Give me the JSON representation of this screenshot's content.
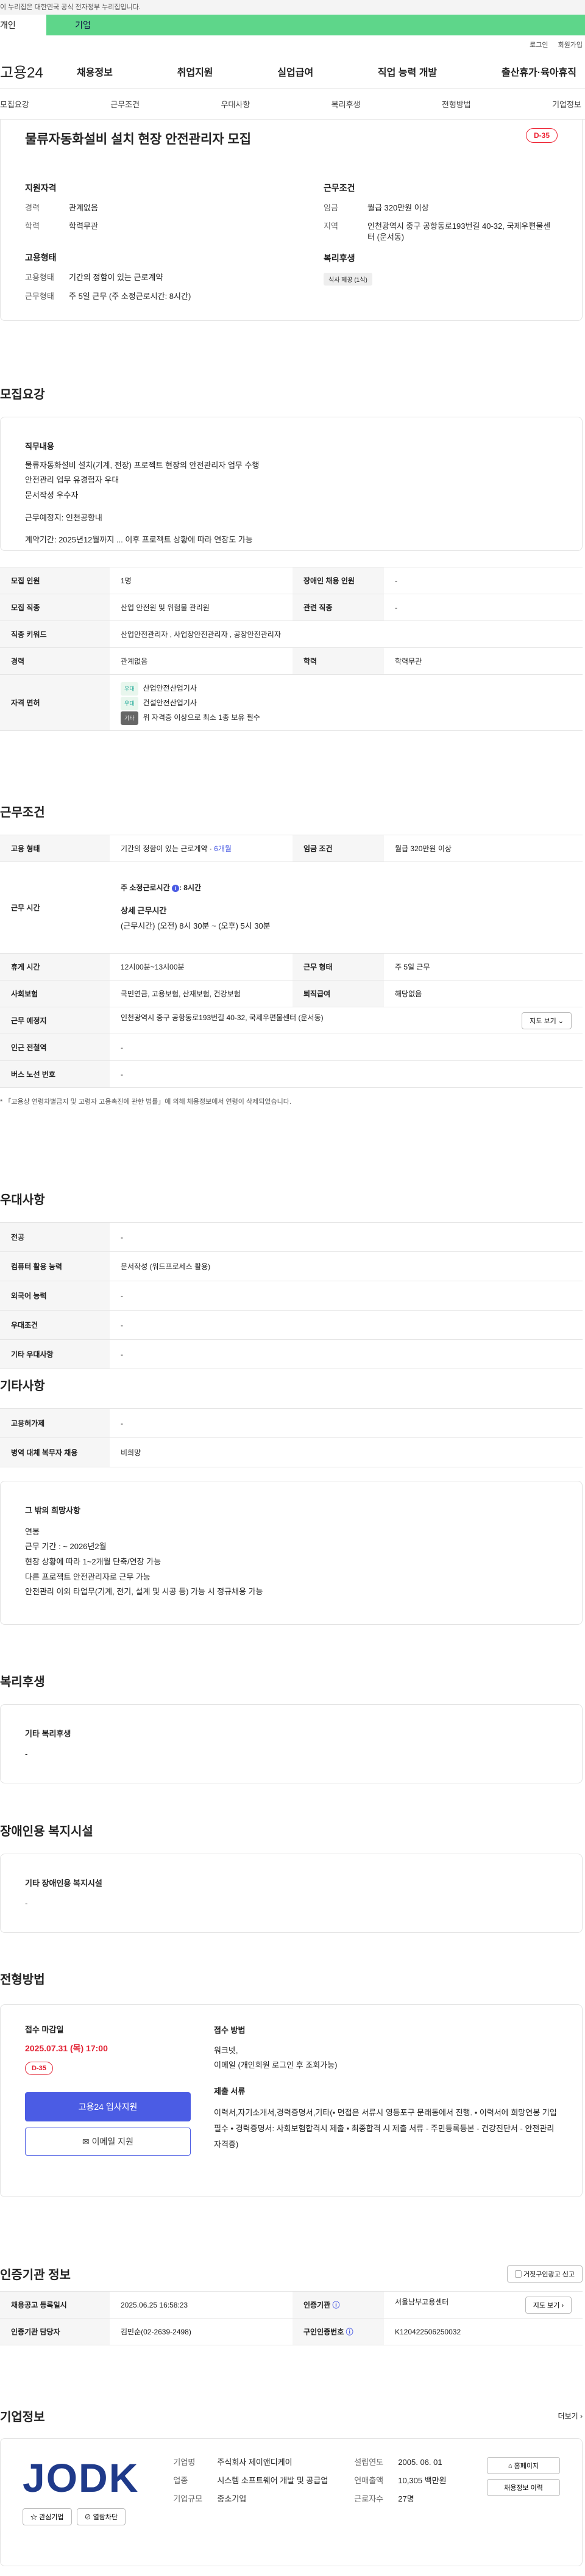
{
  "gov_notice": "이 누리집은 대한민국 공식 전자정부 누리집입니다.",
  "top_tabs": [
    "개인",
    "기업"
  ],
  "util": [
    "로그인",
    "회원가입"
  ],
  "logo": "고용24",
  "gnb": [
    "채용정보",
    "취업지원",
    "실업급여",
    "직업 능력 개발",
    "출산휴가·육아휴직"
  ],
  "subnav": [
    "모집요강",
    "근무조건",
    "우대사항",
    "복리후생",
    "전형방법",
    "기업정보"
  ],
  "title": "물류자동화설비 설치 현장 안전관리자 모집",
  "dday": "D-35",
  "summary": {
    "qual_h": "지원자격",
    "career_k": "경력",
    "career_v": "관계없음",
    "edu_k": "학력",
    "edu_v": "학력무관",
    "cond_h": "근무조건",
    "wage_k": "임금",
    "wage_v": "월급 320만원 이상",
    "area_k": "지역",
    "area_v": "인천광역시 중구 공항동로193번길 40-32, 국제우편물센터 (운서동)",
    "emp_h": "고용형태",
    "emptype_k": "고용형태",
    "emptype_v": "기간의 정함이 있는 근로계약",
    "work_k": "근무형태",
    "work_v": "주 5일 근무 (주 소정근로시간: 8시간)",
    "welfare_h": "복리후생",
    "welfare_chip": "식사 제공 (1식)"
  },
  "recruit": {
    "title": "모집요강",
    "desc_h": "직무내용",
    "desc": [
      "물류자동화설비 설치(기계, 전장) 프로젝트 현장의 안전관리자 업무 수행",
      "안전관리 업무 유경험자 우대",
      "문서작성 우수자",
      "",
      "근무예정지: 인천공항내",
      "",
      "계약기간: 2025년12월까지 ... 이후 프로젝트 상황에 따라 연장도 가능"
    ],
    "rows": {
      "count_k": "모집 인원",
      "count_v": "1명",
      "disabled_k": "장애인 채용 인원",
      "disabled_v": "-",
      "job_k": "모집 직종",
      "job_v": "산업 안전원 및 위험물 관리원",
      "related_k": "관련 직종",
      "related_v": "-",
      "kw_k": "직종 키워드",
      "kw_v": "산업안전관리자 , 사업장안전관리자 , 공장안전관리자",
      "career_k": "경력",
      "career_v": "관계없음",
      "edu_k": "학력",
      "edu_v": "학력무관",
      "lic_k": "자격 면허",
      "lic1_badge": "우대",
      "lic1": "산업안전산업기사",
      "lic2_badge": "우대",
      "lic2": "건설안전산업기사",
      "lic3_badge": "기타",
      "lic3": "위 자격증 이상으로 최소 1종 보유 필수"
    }
  },
  "work": {
    "title": "근무조건",
    "emp_k": "고용 형태",
    "emp_v": "기간의 정함이 있는 근로계약 · ",
    "emp_v2": "6개월",
    "wage_k": "임금 조건",
    "wage_v": "월급 320만원 이상",
    "time_k": "근무 시간",
    "time_l1": "주 소정근로시간",
    "time_l1v": ": 8시간",
    "time_l2": "상세 근무시간",
    "time_l3": "(근무시간) (오전) 8시 30분 ~ (오후) 5시 30분",
    "break_k": "휴게 시간",
    "break_v": "12시00분~13시00분",
    "form_k": "근무 형태",
    "form_v": "주 5일 근무",
    "ins_k": "사회보험",
    "ins_v": "국민연금, 고용보험, 산재보험, 건강보험",
    "ret_k": "퇴직급여",
    "ret_v": "해당없음",
    "place_k": "근무 예정지",
    "place_v": "인천광역시 중구 공항동로193번길 40-32, 국제우편물센터 (운서동)",
    "map_btn": "지도 보기",
    "subway_k": "인근 전철역",
    "subway_v": "-",
    "bus_k": "버스 노선 번호",
    "bus_v": "-",
    "note": "* 「고용상 연령차별금지 및 고령자 고용촉진에 관한 법률」에 의해 채용정보에서 연령이 삭제되었습니다."
  },
  "pref": {
    "title": "우대사항",
    "major_k": "전공",
    "major_v": "-",
    "pc_k": "컴퓨터 활용 능력",
    "pc_v": "문서작성 (워드프로세스 활용)",
    "lang_k": "외국어 능력",
    "lang_v": "-",
    "cond_k": "우대조건",
    "cond_v": "-",
    "etc_k": "기타 우대사항",
    "etc_v": "-"
  },
  "etc": {
    "title": "기타사항",
    "equip_k": "고용허가제",
    "equip_v": "-",
    "mil_k": "병역 대체 복무자 채용",
    "mil_v": "비희망",
    "hope_h": "그 밖의 희망사항",
    "hope": [
      "연봉",
      "근무 기간 : ~ 2026년2월",
      "현장 상황에 따라 1~2개월 단축/연장 가능",
      "다른 프로젝트 안전관리자로 근무 가능",
      "안전관리 이외 타업무(기계, 전기, 설계 및 시공 등) 가능 시 정규채용 가능"
    ]
  },
  "welfare": {
    "title": "복리후생",
    "h": "기타 복리후생",
    "v": "-"
  },
  "disabled": {
    "title": "장애인용 복지시설",
    "h": "기타 장애인용 복지시설",
    "v": "-"
  },
  "selection": {
    "title": "전형방법",
    "deadline_h": "접수 마감일",
    "deadline": "2025.07.31 (목) 17:00",
    "dday": "D-35",
    "apply_btn": "고용24 입사지원",
    "email_btn": "이메일 지원",
    "method_h": "접수 방법",
    "method": [
      "워크넷,",
      "이메일 (개인회원 로그인 후 조회가능)"
    ],
    "docs_h": "제출 서류",
    "docs": "이력서,자기소개서,경력증명서,기타(• 면접은 서류시 영등포구 문래동에서 진행. • 이력서에 희망연봉 기입 필수 • 경력증명서: 사회보험합격시 제출 • 최종합격 시 제출 서류 - 주민등록등본 - 건강진단서 - 안전관리자격증)"
  },
  "cert": {
    "title": "인증기관 정보",
    "report_btn": "거짓구인광고 신고",
    "reg_k": "채용공고 등록일시",
    "reg_v": "2025.06.25 16:58:23",
    "org_k": "인증기관",
    "org_v": "서울남부고용센터",
    "map_btn": "지도 보기",
    "mgr_k": "인증기관 담당자",
    "mgr_v": "김민순(02-2639-2498)",
    "no_k": "구인인증번호",
    "no_v": "K120422506250032"
  },
  "company": {
    "title": "기업정보",
    "more": "더보기",
    "logo_text": "JODK",
    "fav_btn": "관심기업",
    "block_btn": "열람차단",
    "name_k": "기업명",
    "name_v": "주식회사 제이앤디케이",
    "ind_k": "업종",
    "ind_v": "시스템 소프트웨어 개발 및 공급업",
    "size_k": "기업규모",
    "size_v": "중소기업",
    "est_k": "설립연도",
    "est_v": "2005. 06. 01",
    "sales_k": "연매출액",
    "sales_v": "10,305 백만원",
    "emp_k": "근로자수",
    "emp_v": "27명",
    "home_btn": "홈페이지",
    "jobs_btn": "채용정보 이력"
  },
  "colors": {
    "accent": "#4b5ce4",
    "green": "#5ed68a",
    "danger": "#e22233"
  }
}
